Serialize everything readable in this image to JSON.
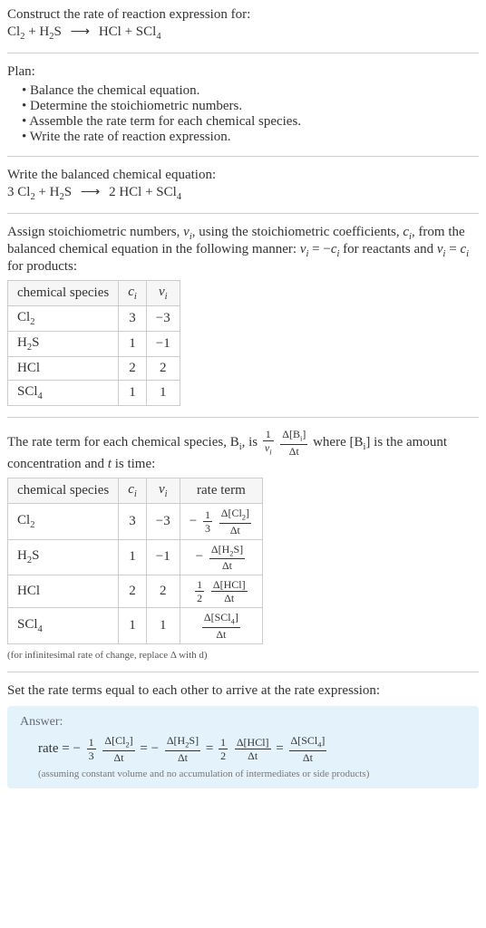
{
  "intro": {
    "prompt": "Construct the rate of reaction expression for:",
    "equation_lhs_1": "Cl",
    "equation_lhs_1_sub": "2",
    "equation_lhs_plus": " + H",
    "equation_lhs_2_sub": "2",
    "equation_lhs_2": "S",
    "equation_arrow": "⟶",
    "equation_rhs": "HCl + SCl",
    "equation_rhs_sub": "4"
  },
  "plan": {
    "heading": "Plan:",
    "step1": "Balance the chemical equation.",
    "step2": "Determine the stoichiometric numbers.",
    "step3": "Assemble the rate term for each chemical species.",
    "step4": "Write the rate of reaction expression."
  },
  "balanced": {
    "heading": "Write the balanced chemical equation:",
    "eq_3": "3 Cl",
    "eq_cl2_sub": "2",
    "eq_plus_h": " + H",
    "eq_h2_sub": "2",
    "eq_s": "S",
    "eq_arrow": "⟶",
    "eq_rhs_2hcl": "2 HCl + SCl",
    "eq_scl4_sub": "4"
  },
  "stoich_text": {
    "part1": "Assign stoichiometric numbers, ",
    "nu": "ν",
    "nu_sub": "i",
    "part2": ", using the stoichiometric coefficients, ",
    "c": "c",
    "c_sub": "i",
    "part3": ", from the balanced chemical equation in the following manner: ",
    "eq1_l": "ν",
    "eq1_l_sub": "i",
    "eq1_eq": " = −",
    "eq1_r": "c",
    "eq1_r_sub": "i",
    "part4": " for reactants and ",
    "eq2_l": "ν",
    "eq2_l_sub": "i",
    "eq2_eq": " = ",
    "eq2_r": "c",
    "eq2_r_sub": "i",
    "part5": " for products:"
  },
  "table1": {
    "h1": "chemical species",
    "h2": "c",
    "h2_sub": "i",
    "h3": "ν",
    "h3_sub": "i",
    "r1c1": "Cl",
    "r1c1_sub": "2",
    "r1c2": "3",
    "r1c3": "−3",
    "r2c1": "H",
    "r2c1_sub": "2",
    "r2c1b": "S",
    "r2c2": "1",
    "r2c3": "−1",
    "r3c1": "HCl",
    "r3c2": "2",
    "r3c3": "2",
    "r4c1": "SCl",
    "r4c1_sub": "4",
    "r4c2": "1",
    "r4c3": "1"
  },
  "rate_text": {
    "part1": "The rate term for each chemical species, B",
    "b_sub": "i",
    "part2": ", is ",
    "frac1_num": "1",
    "frac1_den_nu": "ν",
    "frac1_den_sub": "i",
    "frac2_num_d": "Δ[B",
    "frac2_num_sub": "i",
    "frac2_num_close": "]",
    "frac2_den": "Δt",
    "part3": " where [B",
    "part3_sub": "i",
    "part4": "] is the amount concentration and ",
    "t": "t",
    "part5": " is time:"
  },
  "table2": {
    "h1": "chemical species",
    "h2": "c",
    "h2_sub": "i",
    "h3": "ν",
    "h3_sub": "i",
    "h4": "rate term",
    "r1": {
      "sp": "Cl",
      "sp_sub": "2",
      "c": "3",
      "nu": "−3",
      "neg": "−",
      "coef_num": "1",
      "coef_den": "3",
      "d_num": "Δ[Cl",
      "d_num_sub": "2",
      "d_num_close": "]",
      "d_den": "Δt"
    },
    "r2": {
      "sp": "H",
      "sp_sub": "2",
      "sp_b": "S",
      "c": "1",
      "nu": "−1",
      "neg": "−",
      "d_num": "Δ[H",
      "d_num_sub": "2",
      "d_num_b": "S]",
      "d_den": "Δt"
    },
    "r3": {
      "sp": "HCl",
      "c": "2",
      "nu": "2",
      "coef_num": "1",
      "coef_den": "2",
      "d_num": "Δ[HCl]",
      "d_den": "Δt"
    },
    "r4": {
      "sp": "SCl",
      "sp_sub": "4",
      "c": "1",
      "nu": "1",
      "d_num": "Δ[SCl",
      "d_num_sub": "4",
      "d_num_close": "]",
      "d_den": "Δt"
    },
    "note": "(for infinitesimal rate of change, replace Δ with d)"
  },
  "final": {
    "heading": "Set the rate terms equal to each other to arrive at the rate expression:",
    "answer_label": "Answer:",
    "rate_eq": "rate = ",
    "t1_neg": "−",
    "t1_c_num": "1",
    "t1_c_den": "3",
    "t1_num": "Δ[Cl",
    "t1_num_sub": "2",
    "t1_num_close": "]",
    "t1_den": "Δt",
    "eq1": " = ",
    "t2_neg": "−",
    "t2_num": "Δ[H",
    "t2_num_sub": "2",
    "t2_num_b": "S]",
    "t2_den": "Δt",
    "eq2": " = ",
    "t3_c_num": "1",
    "t3_c_den": "2",
    "t3_num": "Δ[HCl]",
    "t3_den": "Δt",
    "eq3": " = ",
    "t4_num": "Δ[SCl",
    "t4_num_sub": "4",
    "t4_num_close": "]",
    "t4_den": "Δt",
    "assume": "(assuming constant volume and no accumulation of intermediates or side products)"
  }
}
